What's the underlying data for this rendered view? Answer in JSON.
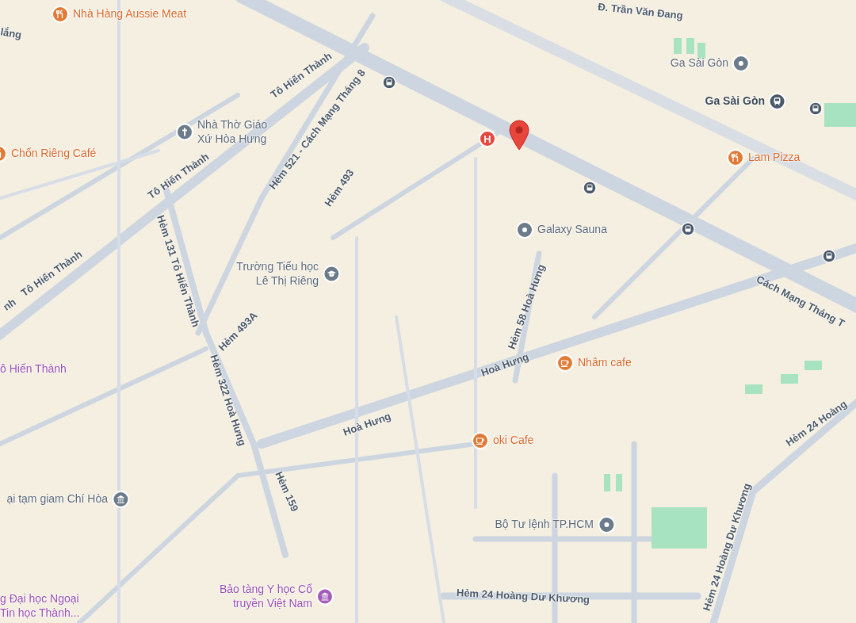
{
  "streets": [
    {
      "text": "Đ. Trần Văn Đang"
    },
    {
      "text": "Tô Hiến Thành"
    },
    {
      "text": "Tô Hiến Thành"
    },
    {
      "text": "Tô Hiến Thành"
    },
    {
      "text": "nh"
    },
    {
      "text": "Hẻm 131 Tô Hiến Thành"
    },
    {
      "text": "Hẻm 521 - Cách Mạng Tháng 8"
    },
    {
      "text": "Hẻm 493"
    },
    {
      "text": "Hẻm 493A"
    },
    {
      "text": "Hẻm 322 Hoà Hưng"
    },
    {
      "text": "Hẻm 159"
    },
    {
      "text": "Hoà Hưng"
    },
    {
      "text": "Hoà Hưng"
    },
    {
      "text": "Hẻm 58 Hoà Hưng"
    },
    {
      "text": "Cách Mạng Tháng T"
    },
    {
      "text": "Hẻm 24 Hoàng Dư Khương"
    },
    {
      "text": "Hẻm 24 Hoàng Dư Khương"
    },
    {
      "text": "Hẻm 24 Hoàng"
    },
    {
      "text": "lắng"
    }
  ],
  "places": [
    {
      "kind": "restaurant",
      "lines": [
        "Nhà Hàng Aussie Meat"
      ]
    },
    {
      "kind": "restaurant",
      "lines": [
        "Chốn Riêng Café"
      ]
    },
    {
      "kind": "church",
      "lines": [
        "Nhà Thờ Giáo",
        "Xứ Hòa Hưng"
      ]
    },
    {
      "kind": "school",
      "lines": [
        "Trường Tiểu học",
        "Lê Thị Riêng"
      ]
    },
    {
      "kind": "place",
      "lines": [
        "Galaxy Sauna"
      ]
    },
    {
      "kind": "place",
      "lines": [
        "Ga Sài Gòn"
      ]
    },
    {
      "kind": "station",
      "lines": [
        "Ga Sài Gòn"
      ]
    },
    {
      "kind": "restaurant",
      "lines": [
        "Lam Pizza"
      ]
    },
    {
      "kind": "cafe",
      "lines": [
        "Nhâm cafe"
      ]
    },
    {
      "kind": "cafe",
      "lines": [
        "oki Cafe"
      ]
    },
    {
      "kind": "place",
      "lines": [
        "Bộ Tư lệnh TP.HCM"
      ]
    },
    {
      "kind": "museum",
      "lines": [
        "Bảo tàng Y học Cổ",
        "truyền Việt Nam"
      ]
    },
    {
      "kind": "district",
      "lines": [
        "ô Hiến Thành"
      ]
    },
    {
      "kind": "landmark",
      "lines": [
        "ại tạm giam Chí Hòa"
      ]
    },
    {
      "kind": "district",
      "lines": [
        "g Đại học Ngoại",
        "Tin học Thành..."
      ]
    }
  ],
  "markers": [
    {
      "kind": "hospital",
      "text": "H"
    },
    {
      "kind": "pin"
    },
    {
      "kind": "bus"
    },
    {
      "kind": "bus"
    },
    {
      "kind": "bus"
    },
    {
      "kind": "bus"
    },
    {
      "kind": "bus"
    }
  ]
}
